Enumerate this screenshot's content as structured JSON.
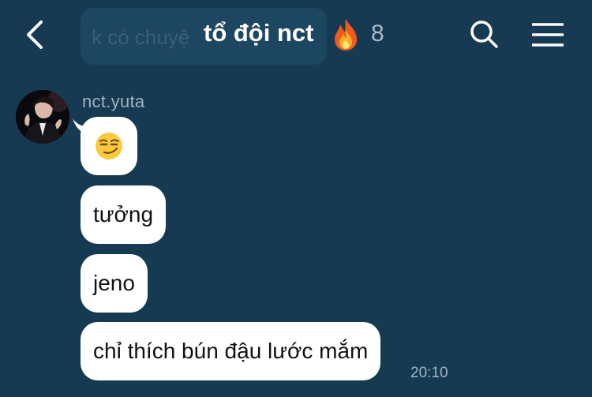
{
  "header": {
    "title": "tổ đội nct",
    "member_count": "8",
    "behind_text": "k có chuyệ",
    "fire_icon": "fire-emoji",
    "back_icon": "chevron-left-icon",
    "search_icon": "search-icon",
    "menu_icon": "hamburger-menu-icon"
  },
  "conversation": {
    "sender": "nct.yuta",
    "messages": [
      {
        "kind": "emoji",
        "text": "",
        "emoji": "smirk-face"
      },
      {
        "kind": "text",
        "text": "tưởng"
      },
      {
        "kind": "text",
        "text": "jeno"
      },
      {
        "kind": "text",
        "text": "chỉ thích bún đậu lước mắm"
      }
    ],
    "timestamp": "20:10"
  },
  "colors": {
    "background": "#163a51",
    "bubble": "#ffffff",
    "muted_text": "#9fb2c0"
  }
}
